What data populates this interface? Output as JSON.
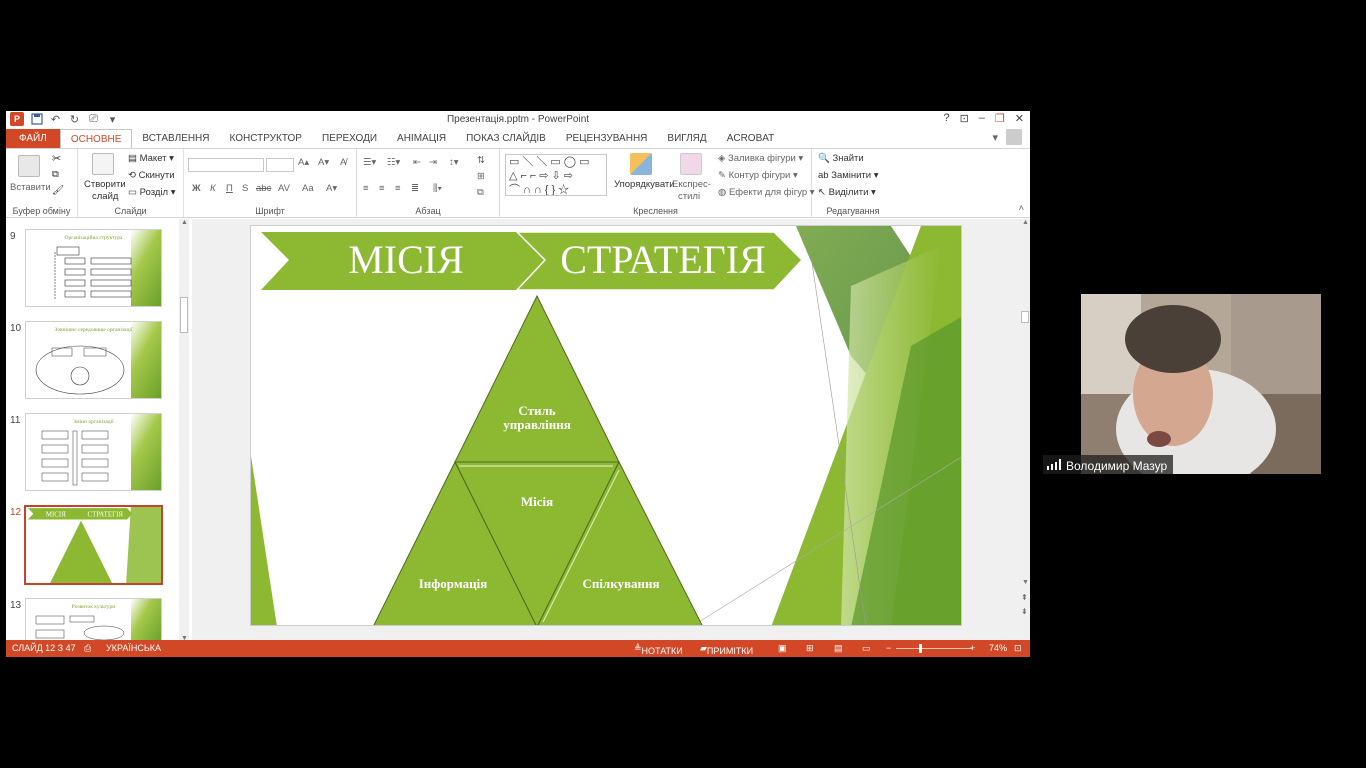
{
  "window": {
    "title": "Презентація.pptm - PowerPoint",
    "help": "?",
    "minimize": "–",
    "restore": "❐",
    "close": "✕"
  },
  "tabs": [
    "ФАЙЛ",
    "ОСНОВНЕ",
    "ВСТАВЛЕННЯ",
    "КОНСТРУКТОР",
    "ПЕРЕХОДИ",
    "АНІМАЦІЯ",
    "ПОКАЗ СЛАЙДІВ",
    "РЕЦЕНЗУВАННЯ",
    "ВИГЛЯД",
    "ACROBAT"
  ],
  "ribbon": {
    "clipboard": {
      "paste": "Вставити",
      "label": "Буфер обміну"
    },
    "slides": {
      "new_slide": "Створити",
      "new_slide2": "слайд",
      "layout": "Макет",
      "reset": "Скинути",
      "section": "Розділ",
      "label": "Слайди"
    },
    "font": {
      "label": "Шрифт",
      "bold": "Ж",
      "italic": "К",
      "underline": "П",
      "shadow": "S",
      "strike": "abc"
    },
    "paragraph": {
      "label": "Абзац"
    },
    "drawing": {
      "arrange": "Упорядкувати",
      "quick_styles": "Експрес-",
      "quick_styles2": "стилі",
      "fill": "Заливка фігури",
      "outline": "Контур фігури",
      "effects": "Ефекти для фігур",
      "label": "Креслення"
    },
    "editing": {
      "find": "Знайти",
      "replace": "Замінити",
      "select": "Виділити",
      "label": "Редагування"
    }
  },
  "thumbnails": [
    {
      "num": "9",
      "title": "Організаційна структура"
    },
    {
      "num": "10",
      "title": "Зовнішнє середовище організації"
    },
    {
      "num": "11",
      "title": "Зміни організації"
    },
    {
      "num": "12",
      "title": ""
    },
    {
      "num": "13",
      "title": "Розвиток культури"
    }
  ],
  "slide": {
    "banner_left": "МІСІЯ",
    "banner_right": "СТРАТЕГІЯ",
    "tri_top_1": "Стиль",
    "tri_top_2": "управління",
    "tri_center": "Місія",
    "tri_left": "Інформація",
    "tri_right": "Спілкування",
    "green_light": "#8cb832",
    "green_dark": "#5e9a2c"
  },
  "status": {
    "slide": "СЛАЙД 12 З 47",
    "language": "УКРАЇНСЬКА",
    "notes": "НОТАТКИ",
    "comments": "ПРИМІТКИ",
    "zoom": "74%",
    "bar_color": "#d24726"
  },
  "video": {
    "name": "Володимир Мазур"
  }
}
